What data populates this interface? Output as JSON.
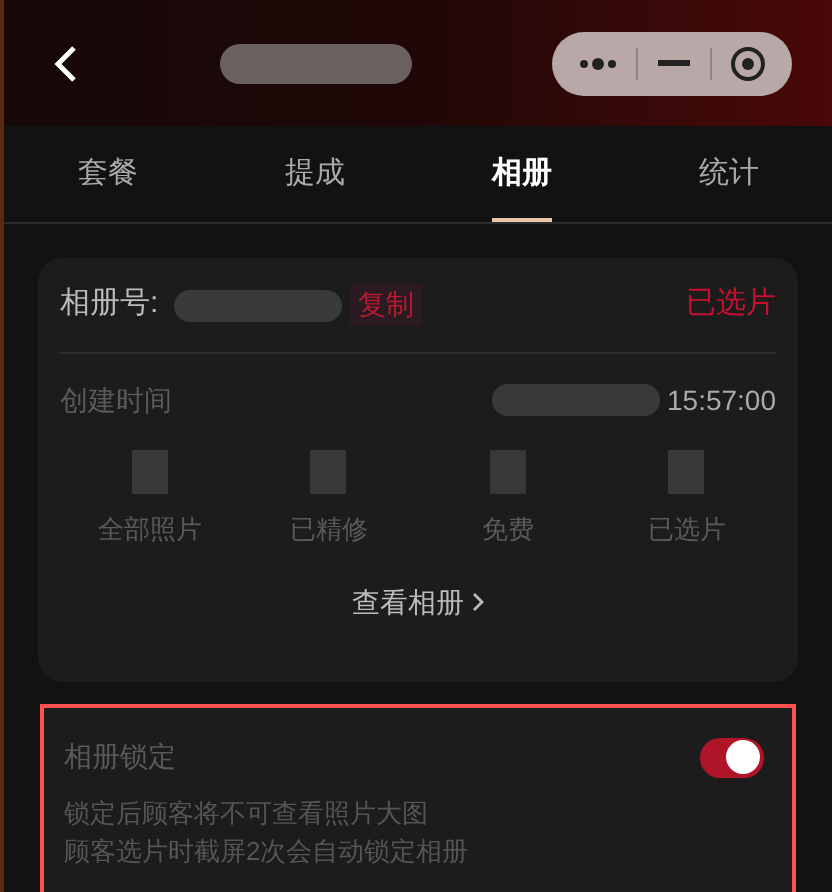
{
  "tabs": [
    {
      "label": "套餐",
      "selected": false
    },
    {
      "label": "提成",
      "selected": false
    },
    {
      "label": "相册",
      "selected": true
    },
    {
      "label": "统计",
      "selected": false
    }
  ],
  "album": {
    "number_label": "相册号:",
    "copy": "复制",
    "status": "已选片",
    "created_label": "创建时间",
    "created_time": "15:57:00",
    "stats": [
      {
        "label": "全部照片"
      },
      {
        "label": "已精修"
      },
      {
        "label": "免费"
      },
      {
        "label": "已选片"
      }
    ],
    "view_link": "查看相册"
  },
  "lock": {
    "title": "相册锁定",
    "on": true,
    "notes": [
      "锁定后顾客将不可查看照片大图",
      "顾客选片时截屏2次会自动锁定相册"
    ]
  }
}
